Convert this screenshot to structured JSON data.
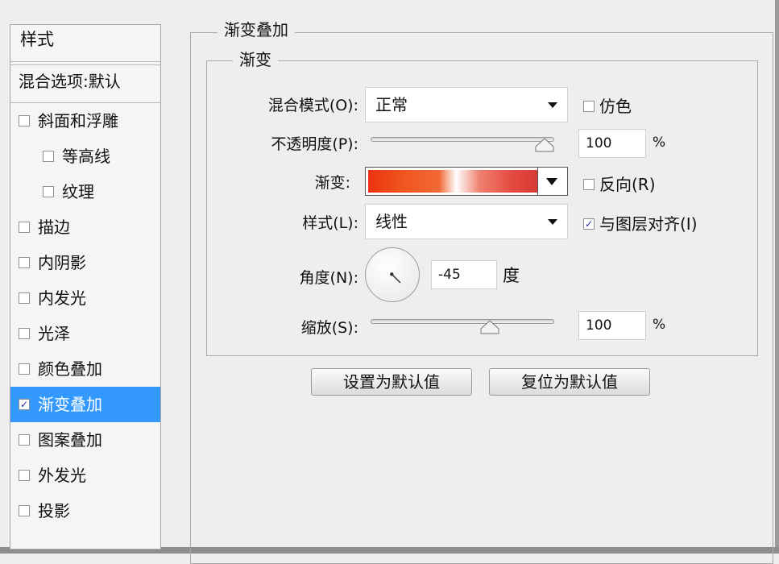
{
  "sidebar": {
    "header": "样式",
    "blending": "混合选项:默认",
    "items": [
      {
        "label": "斜面和浮雕",
        "checked": false,
        "level": 0
      },
      {
        "label": "等高线",
        "checked": false,
        "level": 1
      },
      {
        "label": "纹理",
        "checked": false,
        "level": 1
      },
      {
        "label": "描边",
        "checked": false,
        "level": 0
      },
      {
        "label": "内阴影",
        "checked": false,
        "level": 0
      },
      {
        "label": "内发光",
        "checked": false,
        "level": 0
      },
      {
        "label": "光泽",
        "checked": false,
        "level": 0
      },
      {
        "label": "颜色叠加",
        "checked": false,
        "level": 0
      },
      {
        "label": "渐变叠加",
        "checked": true,
        "level": 0,
        "selected": true
      },
      {
        "label": "图案叠加",
        "checked": false,
        "level": 0
      },
      {
        "label": "外发光",
        "checked": false,
        "level": 0
      },
      {
        "label": "投影",
        "checked": false,
        "level": 0
      }
    ]
  },
  "panel": {
    "title": "渐变叠加",
    "group_title": "渐变",
    "blend_mode_label": "混合模式(O):",
    "blend_mode_value": "正常",
    "dither_label": "仿色",
    "dither_checked": false,
    "opacity_label": "不透明度(P):",
    "opacity_value": "100",
    "opacity_unit": "%",
    "opacity_level": 100,
    "gradient_label": "渐变:",
    "reverse_label": "反向(R)",
    "reverse_checked": false,
    "style_label": "样式(L):",
    "style_value": "线性",
    "align_label": "与图层对齐(I)",
    "align_checked": true,
    "angle_label": "角度(N):",
    "angle_value": "-45",
    "angle_unit": "度",
    "scale_label": "缩放(S):",
    "scale_value": "100",
    "scale_unit": "%",
    "scale_level": 100,
    "btn_make_default": "设置为默认值",
    "btn_reset_default": "复位为默认值"
  },
  "colors": {
    "selected_bg": "#3399ff",
    "gradient_start": "#ee3310",
    "gradient_end": "#d63a33"
  }
}
